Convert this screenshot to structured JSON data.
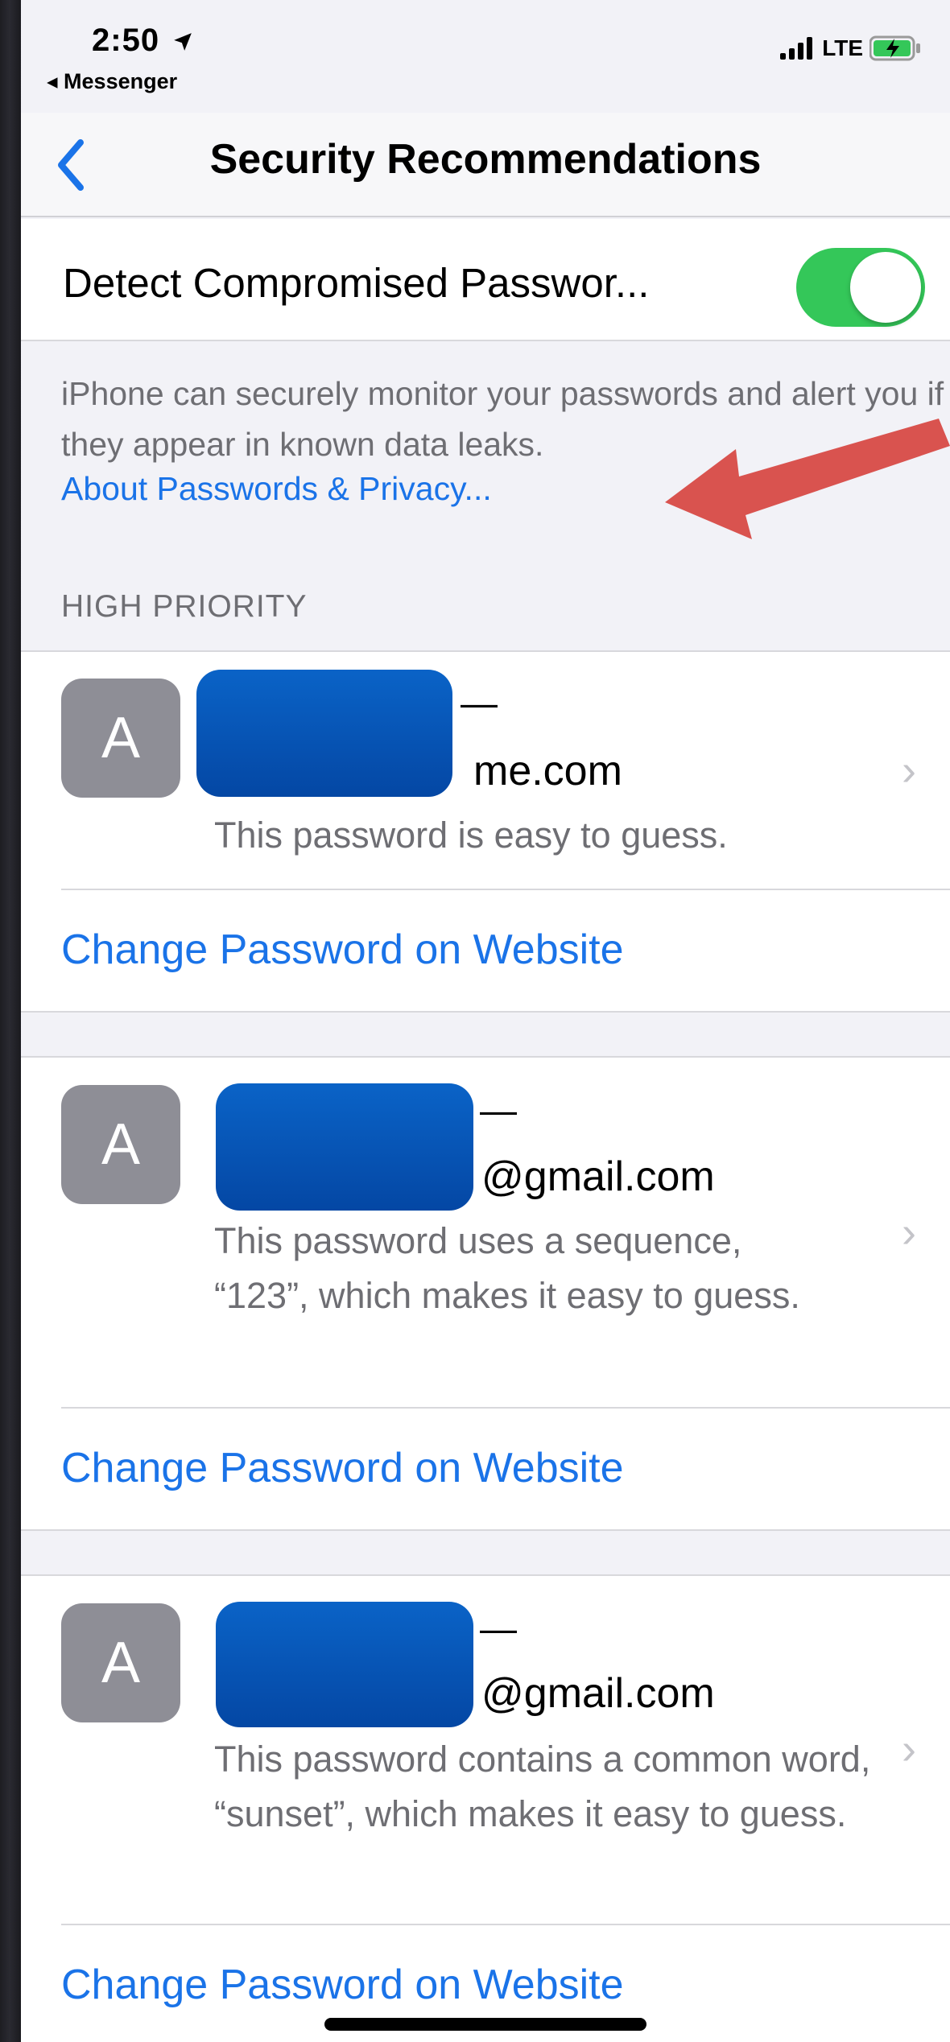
{
  "status_bar": {
    "time": "2:50",
    "back_app": "◂ Messenger",
    "network": "LTE"
  },
  "nav": {
    "title": "Security Recommendations"
  },
  "detect_toggle": {
    "label": "Detect Compromised Passwor...",
    "on": true
  },
  "description": {
    "text": "iPhone can securely monitor your passwords and alert you if they appear in known data leaks.",
    "link": "About Passwords & Privacy..."
  },
  "section": {
    "header": "HIGH PRIORITY"
  },
  "items": [
    {
      "avatar_letter": "A",
      "account_dash": "—",
      "account_suffix": "me.com",
      "message": "This password is easy to guess.",
      "action": "Change Password on Website"
    },
    {
      "avatar_letter": "A",
      "account_dash": "—",
      "account_suffix": "@gmail.com",
      "message": "This password uses a sequence, “123”, which makes it easy to guess.",
      "action": "Change Password on Website"
    },
    {
      "avatar_letter": "A",
      "account_dash": "—",
      "account_suffix": "@gmail.com",
      "message": "This password contains a common word, “sunset”, which makes it easy to guess.",
      "action": "Change Password on Website"
    }
  ],
  "colors": {
    "accent": "#1a73e8",
    "toggle_on": "#34c759",
    "annotation_arrow": "#d9534f",
    "redaction": "#0a55b8"
  }
}
